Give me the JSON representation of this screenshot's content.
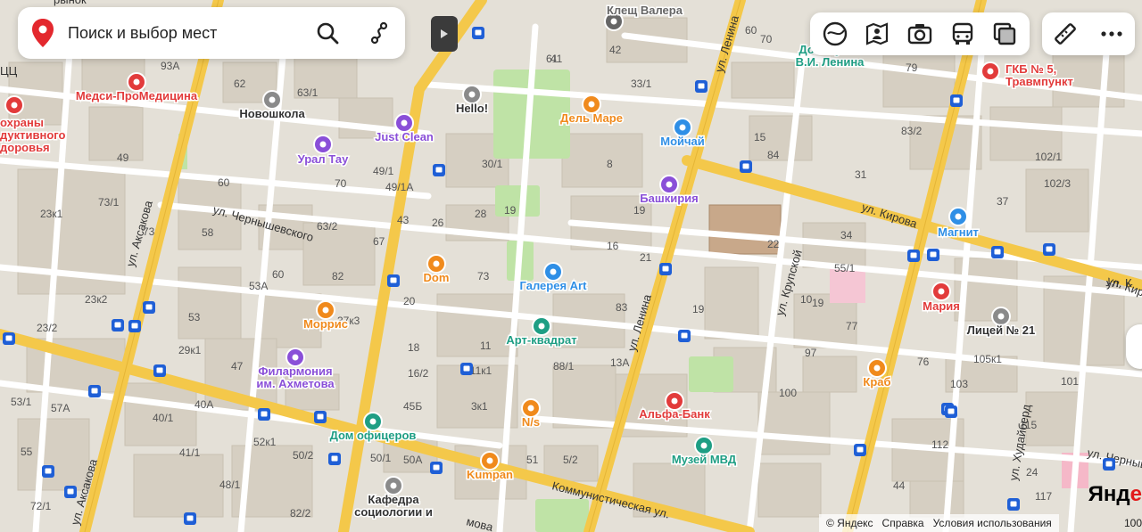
{
  "search": {
    "placeholder": "Поиск и выбор мест"
  },
  "footer": {
    "copyright": "© Яндекс",
    "help": "Справка",
    "terms": "Условия использования"
  },
  "brand": {
    "prefix": "Янд",
    "accent": "е"
  },
  "scale": {
    "label": "100"
  },
  "colors": {
    "road_major": "#f4c84a",
    "road_minor": "#ffffff",
    "block": "#e2ddd2",
    "building": "#d5cfc2",
    "park": "#bfe3a6",
    "label": "#333333",
    "poi_orange": "#f08a1c",
    "poi_purple": "#8a4fd8",
    "poi_blue": "#2f8fe6",
    "poi_teal": "#1e9e84",
    "poi_red": "#e23b3b",
    "metro_blue": "#1f5fd6"
  },
  "streets": [
    {
      "name": "ул. Аксакова"
    },
    {
      "name": "ул. Аксакова"
    },
    {
      "name": "ул. Чернышевского"
    },
    {
      "name": "ул. Ленина"
    },
    {
      "name": "ул. Ленина"
    },
    {
      "name": "ул. Кирова"
    },
    {
      "name": "ул. Кирова"
    },
    {
      "name": "ул. Крупской"
    },
    {
      "name": "Коммунистическая ул."
    },
    {
      "name": "ул. Худайберд"
    },
    {
      "name": "ул. Чернышев"
    },
    {
      "name": "мова"
    }
  ],
  "pois": [
    {
      "name": "Клещ Валера",
      "icon": "spider-icon"
    },
    {
      "name": "Дом-музей В.И. Ленина",
      "icon": "museum-icon"
    },
    {
      "name": "ГКБ № 5, Травмпункт",
      "icon": "hospital-icon"
    },
    {
      "name": "Медси-ПроМедицина",
      "icon": "hospital-icon"
    },
    {
      "name": "Новошкола",
      "icon": "school-icon"
    },
    {
      "name": "Hello!",
      "icon": "school-icon"
    },
    {
      "name": "Дель Маре",
      "icon": "restaurant-icon"
    },
    {
      "name": "Just Clean",
      "icon": "cleaning-icon"
    },
    {
      "name": "Мойчай",
      "icon": "shop-icon"
    },
    {
      "name": "Урал Тау",
      "icon": "hotel-icon"
    },
    {
      "name": "Башкирия",
      "icon": "hotel-icon"
    },
    {
      "name": "Магнит",
      "icon": "shop-icon"
    },
    {
      "name": "Dom",
      "icon": "restaurant-icon"
    },
    {
      "name": "Галерея Art",
      "icon": "shop-icon"
    },
    {
      "name": "Мария",
      "icon": "shop-icon"
    },
    {
      "name": "Моррис",
      "icon": "restaurant-icon"
    },
    {
      "name": "Арт-квадрат",
      "icon": "museum-icon"
    },
    {
      "name": "Лицей № 21",
      "icon": "school-icon"
    },
    {
      "name": "Филармония им. Ахметова",
      "icon": "theater-icon"
    },
    {
      "name": "Альфа-Банк",
      "icon": "bank-icon"
    },
    {
      "name": "Краб",
      "icon": "restaurant-icon"
    },
    {
      "name": "N/s",
      "icon": "bar-icon"
    },
    {
      "name": "Дом офицеров",
      "icon": "star-icon"
    },
    {
      "name": "Музей МВД",
      "icon": "museum-icon"
    },
    {
      "name": "Kumpan",
      "icon": "cafe-icon"
    },
    {
      "name": "Кафедра социологии и",
      "icon": "school-icon"
    },
    {
      "name": "охраны дуктивного доровья",
      "icon": "hospital-icon"
    }
  ],
  "house_numbers": [
    "61",
    "42",
    "70",
    "93А",
    "62",
    "63/1",
    "41",
    "33/1",
    "60",
    "79",
    "49",
    "49/1",
    "30/1",
    "8",
    "84",
    "102/3",
    "102/1",
    "83/2",
    "31",
    "15",
    "73/1",
    "37",
    "60",
    "70",
    "49/1А",
    "19",
    "22",
    "28",
    "34",
    "23к1",
    "63/2",
    "43",
    "26",
    "19",
    "16",
    "58",
    "67",
    "21",
    "55/1",
    "53А",
    "60",
    "82",
    "73",
    "73",
    "83",
    "10",
    "19",
    "23к2",
    "20",
    "37к3",
    "53",
    "19",
    "77",
    "97",
    "23/2",
    "29к1",
    "18",
    "11",
    "88/1",
    "76",
    "105к1",
    "47",
    "16/2",
    "111к1",
    "13А",
    "103",
    "101",
    "53/1",
    "57А",
    "40А",
    "45Б",
    "3к1",
    "100",
    "115",
    "40/1",
    "52к1",
    "55",
    "50/2",
    "50/1",
    "50А",
    "51",
    "5/2",
    "112",
    "41/1",
    "48/1",
    "44",
    "72/1",
    "82/2",
    "117",
    "24"
  ],
  "street_labels": [
    "ул. Аксакова",
    "ул. Аксакова",
    "ул. Чернышевского",
    "ул. Ленина",
    "ул. Ленина",
    "ул. Кирова",
    "ул. Кирова",
    "ул. Крупской",
    "Коммунистическая ул.",
    "ул. Худайберд",
    "ул. Чернышев",
    "мова"
  ],
  "corner_labels": [
    "рынок",
    "ЦЦ",
    "ул. К"
  ]
}
